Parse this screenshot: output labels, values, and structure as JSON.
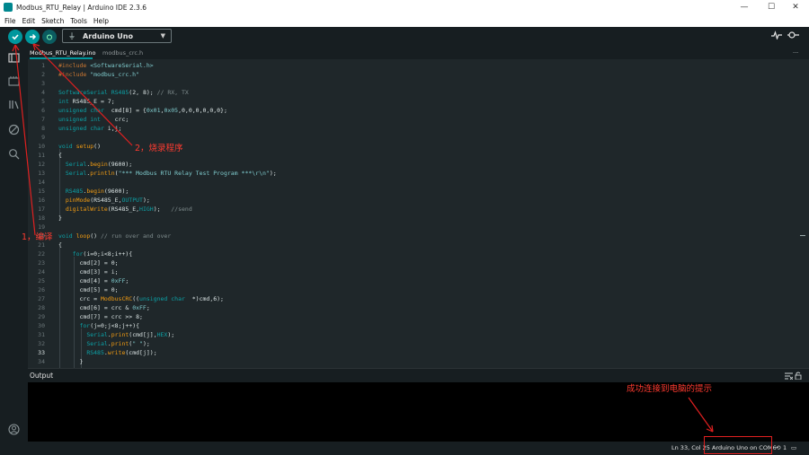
{
  "window": {
    "title": "Modbus_RTU_Relay | Arduino IDE 2.3.6",
    "controls": [
      "—",
      "☐",
      "✕"
    ]
  },
  "menu": [
    "File",
    "Edit",
    "Sketch",
    "Tools",
    "Help"
  ],
  "toolbar": {
    "board": "Arduino Uno",
    "verify": "verify-icon",
    "upload": "upload-icon",
    "debug": "debug-icon"
  },
  "tabs": [
    {
      "label": "Modbus_RTU_Relay.ino",
      "active": true
    },
    {
      "label": "modbus_crc.h",
      "active": false
    }
  ],
  "tab_more": "···",
  "code": [
    {
      "n": "1",
      "t": "#include <SoftwareSerial.h>"
    },
    {
      "n": "2",
      "t": "#include \"modbus_crc.h\""
    },
    {
      "n": "3",
      "t": ""
    },
    {
      "n": "4",
      "t": "SoftwareSerial RS485(2, 8); // RX, TX"
    },
    {
      "n": "5",
      "t": "int RS485_E = 7;"
    },
    {
      "n": "6",
      "t": "unsigned char  cmd[8] = {0x01,0x05,0,0,0,0,0,0};"
    },
    {
      "n": "7",
      "t": "unsigned int    crc;"
    },
    {
      "n": "8",
      "t": "unsigned char i,j;"
    },
    {
      "n": "9",
      "t": ""
    },
    {
      "n": "10",
      "t": "void setup()"
    },
    {
      "n": "11",
      "t": "{"
    },
    {
      "n": "12",
      "t": "  Serial.begin(9600);"
    },
    {
      "n": "13",
      "t": "  Serial.println(\"*** Modbus RTU Relay Test Program ***\\r\\n\");"
    },
    {
      "n": "14",
      "t": ""
    },
    {
      "n": "15",
      "t": "  RS485.begin(9600);"
    },
    {
      "n": "16",
      "t": "  pinMode(RS485_E,OUTPUT);"
    },
    {
      "n": "17",
      "t": "  digitalWrite(RS485_E,HIGH);   //send"
    },
    {
      "n": "18",
      "t": "}"
    },
    {
      "n": "19",
      "t": ""
    },
    {
      "n": "20",
      "t": "void loop() // run over and over"
    },
    {
      "n": "21",
      "t": "{"
    },
    {
      "n": "22",
      "t": "    for(i=0;i<8;i++){"
    },
    {
      "n": "23",
      "t": "      cmd[2] = 0;"
    },
    {
      "n": "24",
      "t": "      cmd[3] = i;"
    },
    {
      "n": "25",
      "t": "      cmd[4] = 0xFF;"
    },
    {
      "n": "26",
      "t": "      cmd[5] = 0;"
    },
    {
      "n": "27",
      "t": "      crc = ModbusCRC((unsigned char  *)cmd,6);"
    },
    {
      "n": "28",
      "t": "      cmd[6] = crc & 0xFF;"
    },
    {
      "n": "29",
      "t": "      cmd[7] = crc >> 8;"
    },
    {
      "n": "30",
      "t": "      for(j=0;j<8;j++){"
    },
    {
      "n": "31",
      "t": "        Serial.print(cmd[j],HEX);"
    },
    {
      "n": "32",
      "t": "        Serial.print(\" \");"
    },
    {
      "n": "33",
      "t": "        RS485.write(cmd[j]);"
    },
    {
      "n": "34",
      "t": "      }"
    }
  ],
  "current_line": "33",
  "output": {
    "label": "Output"
  },
  "status": {
    "cursor": "Ln 33, Col 25",
    "board_port": "Arduino Uno on COM6",
    "notifications": "1"
  },
  "annotations": {
    "compile": "1，编译",
    "upload": "2，烧录程序",
    "connected": "成功连接到电脑的提示"
  },
  "colors": {
    "accent": "#00979d",
    "annotation": "#ff3b30",
    "editor_bg": "#1f272a",
    "chrome_bg": "#171e21"
  }
}
